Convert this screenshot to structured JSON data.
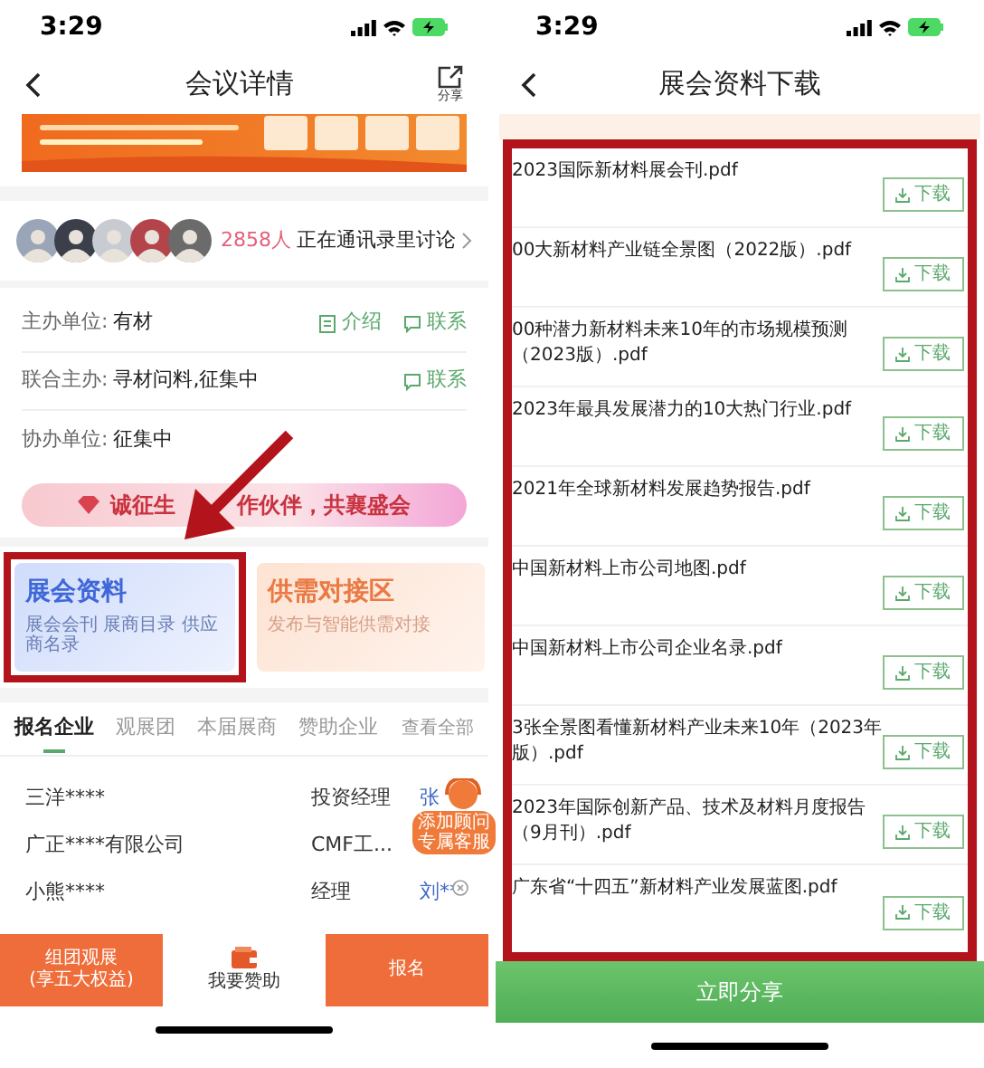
{
  "left": {
    "status_time": "3:29",
    "title": "会议详情",
    "share_label": "分享",
    "banner": {
      "kind": "picture"
    },
    "avatars": [
      {
        "kind": "avatar"
      },
      {
        "kind": "avatar"
      },
      {
        "kind": "avatar"
      },
      {
        "kind": "avatar"
      },
      {
        "kind": "avatar"
      }
    ],
    "discussion": {
      "count": "2858人",
      "text": "正在通讯录里讨论"
    },
    "info_rows": [
      {
        "label": "主办单位:",
        "value": "有材",
        "actions": [
          {
            "label": "介绍",
            "kind": "doc"
          },
          {
            "label": "联系",
            "kind": "chat"
          }
        ]
      },
      {
        "label": "联合主办:",
        "value": "寻材问料,征集中",
        "actions": [
          {
            "label": "联系",
            "kind": "chat"
          }
        ]
      },
      {
        "label": "协办单位:",
        "value": "征集中",
        "actions": []
      }
    ],
    "partner_banner": [
      "诚征生",
      "作伙伴，共襄盛会"
    ],
    "cards": [
      {
        "title": "展会资料",
        "subtitle": "展会会刊 展商目录 供应商名录",
        "kind": "blue",
        "highlighted": true
      },
      {
        "title": "供需对接区",
        "subtitle": "发布与智能供需对接",
        "kind": "orange",
        "highlighted": false
      }
    ],
    "tabs": [
      {
        "label": "报名企业",
        "selected": true
      },
      {
        "label": "观展团",
        "selected": false
      },
      {
        "label": "本届展商",
        "selected": false
      },
      {
        "label": "赞助企业",
        "selected": false
      }
    ],
    "view_all": "查看全部",
    "rows": [
      {
        "company": "三洋****",
        "role": "投资经理",
        "contact": "张"
      },
      {
        "company": "广正****有限公司",
        "role": "CMF工...",
        "contact": ""
      },
      {
        "company": "小熊****",
        "role": "经理",
        "contact": "刘**"
      }
    ],
    "service_badge": [
      "添加顾问",
      "专属客服"
    ],
    "bottom_bar": [
      {
        "kind": "orange",
        "lines": [
          "组团观展",
          "(享五大权益)"
        ]
      },
      {
        "kind": "icon",
        "lines": [
          "我要赞助"
        ]
      },
      {
        "kind": "orange",
        "lines": [
          "报名"
        ]
      }
    ]
  },
  "right": {
    "status_time": "3:29",
    "title": "展会资料下载",
    "files": [
      {
        "name": "2023国际新材料展会刊.pdf",
        "button": "下载"
      },
      {
        "name": "00大新材料产业链全景图（2022版）.pdf",
        "button": "下载"
      },
      {
        "name": "00种潜力新材料未来10年的市场规模预测（2023版）.pdf",
        "button": "下载"
      },
      {
        "name": "2023年最具发展潜力的10大热门行业.pdf",
        "button": "下载"
      },
      {
        "name": "2021年全球新材料发展趋势报告.pdf",
        "button": "下载"
      },
      {
        "name": "中国新材料上市公司地图.pdf",
        "button": "下载"
      },
      {
        "name": "中国新材料上市公司企业名录.pdf",
        "button": "下载"
      },
      {
        "name": "3张全景图看懂新材料产业未来10年（2023年版）.pdf",
        "button": "下载"
      },
      {
        "name": "2023年国际创新产品、技术及材料月度报告（9月刊）.pdf",
        "button": "下载"
      },
      {
        "name": "广东省“十四五”新材料产业发展蓝图.pdf",
        "button": "下载"
      }
    ],
    "share_button": "立即分享"
  }
}
